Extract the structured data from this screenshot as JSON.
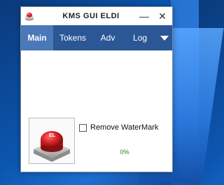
{
  "window": {
    "title": "KMS GUI ELDI",
    "minimize": "—",
    "close": "✕"
  },
  "tabs": [
    {
      "label": "Main",
      "active": true
    },
    {
      "label": "Tokens",
      "active": false
    },
    {
      "label": "Adv",
      "active": false
    },
    {
      "label": "Log",
      "active": false
    }
  ],
  "main": {
    "button_badge": "EL",
    "remove_watermark_label": "Remove WaterMark",
    "remove_watermark_checked": false,
    "progress_text": "0%"
  },
  "colors": {
    "tab_bar": "#2b5797",
    "tab_active": "#4a78b8",
    "progress_text": "#1a8a1a",
    "button_red": "#d8262a"
  }
}
